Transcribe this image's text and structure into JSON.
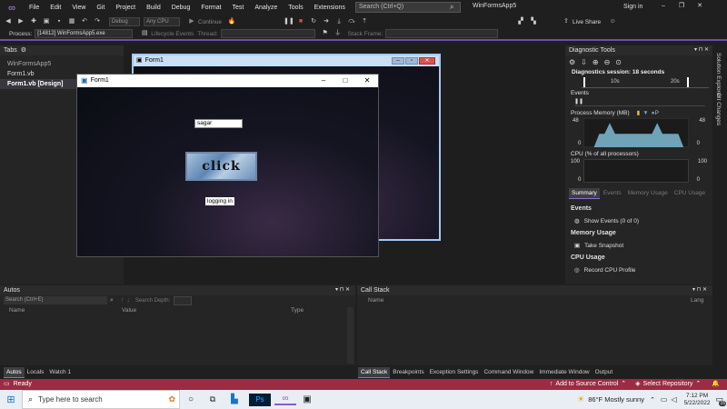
{
  "menubar": {
    "items": [
      "File",
      "Edit",
      "View",
      "Git",
      "Project",
      "Build",
      "Debug",
      "Format",
      "Test",
      "Analyze",
      "Tools",
      "Extensions",
      "Window",
      "Help"
    ],
    "search_placeholder": "Search (Ctrl+Q)",
    "solution_name": "WinFormsApp5",
    "sign_in": "Sign in",
    "live_share": "Live Share"
  },
  "toolbar": {
    "config": "Debug",
    "platform": "Any CPU",
    "continue": "Continue",
    "process_label": "Process:",
    "process_value": "[14812] WinFormsApp5.exe",
    "lifecycle_events": "Lifecycle Events",
    "thread_label": "Thread:",
    "stack_frame_label": "Stack Frame:"
  },
  "left_panel": {
    "tab_title": "Tabs",
    "items": [
      "WinFormsApp5",
      "Form1.vb",
      "Form1.vb [Design]"
    ]
  },
  "bg_form": {
    "title": "Form1"
  },
  "form1": {
    "title": "Form1",
    "textbox_value": "sagar",
    "button_label": "click",
    "status_label": "logging in"
  },
  "diagnostics": {
    "title": "Diagnostic Tools",
    "session": "Diagnostics session: 18 seconds",
    "timeline_labels": [
      "10s",
      "20s"
    ],
    "events_header": "Events",
    "memory_header": "Process Memory (MB)",
    "memory_legend_p": "P",
    "memory_max": "48",
    "memory_min": "0",
    "cpu_header": "CPU (% of all processors)",
    "cpu_max": "100",
    "cpu_min": "0",
    "tabs": [
      "Summary",
      "Events",
      "Memory Usage",
      "CPU Usage"
    ],
    "summary": {
      "events_title": "Events",
      "show_events": "Show Events (0 of 0)",
      "memory_title": "Memory Usage",
      "take_snapshot": "Take Snapshot",
      "cpu_title": "CPU Usage",
      "record_cpu": "Record CPU Profile"
    }
  },
  "side_strip": [
    "Solution Explorer",
    "Git Changes"
  ],
  "autos": {
    "title": "Autos",
    "search_placeholder": "Search (Ctrl+E)",
    "search_depth": "Search Depth:",
    "columns": [
      "Name",
      "Value",
      "Type"
    ],
    "tabs": [
      "Autos",
      "Locals",
      "Watch 1"
    ]
  },
  "callstack": {
    "title": "Call Stack",
    "columns": [
      "Name",
      "Lang"
    ],
    "tabs": [
      "Call Stack",
      "Breakpoints",
      "Exception Settings",
      "Command Window",
      "Immediate Window",
      "Output"
    ]
  },
  "statusbar": {
    "ready": "Ready",
    "add_source_control": "Add to Source Control",
    "select_repository": "Select Repository"
  },
  "taskbar": {
    "search_placeholder": "Type here to search",
    "weather": "86°F  Mostly sunny",
    "time": "7:12 PM",
    "date": "5/22/2022",
    "notification_count": "15"
  },
  "colors": {
    "accent": "#6b4fb0",
    "statusbar": "#9c2b44",
    "memory_fill": "#6fa3b8"
  },
  "memory_series": [
    0,
    0,
    0,
    22,
    22,
    40,
    22,
    22,
    22,
    22,
    22,
    22,
    22,
    22,
    40,
    22,
    22,
    22,
    22,
    0,
    0
  ]
}
